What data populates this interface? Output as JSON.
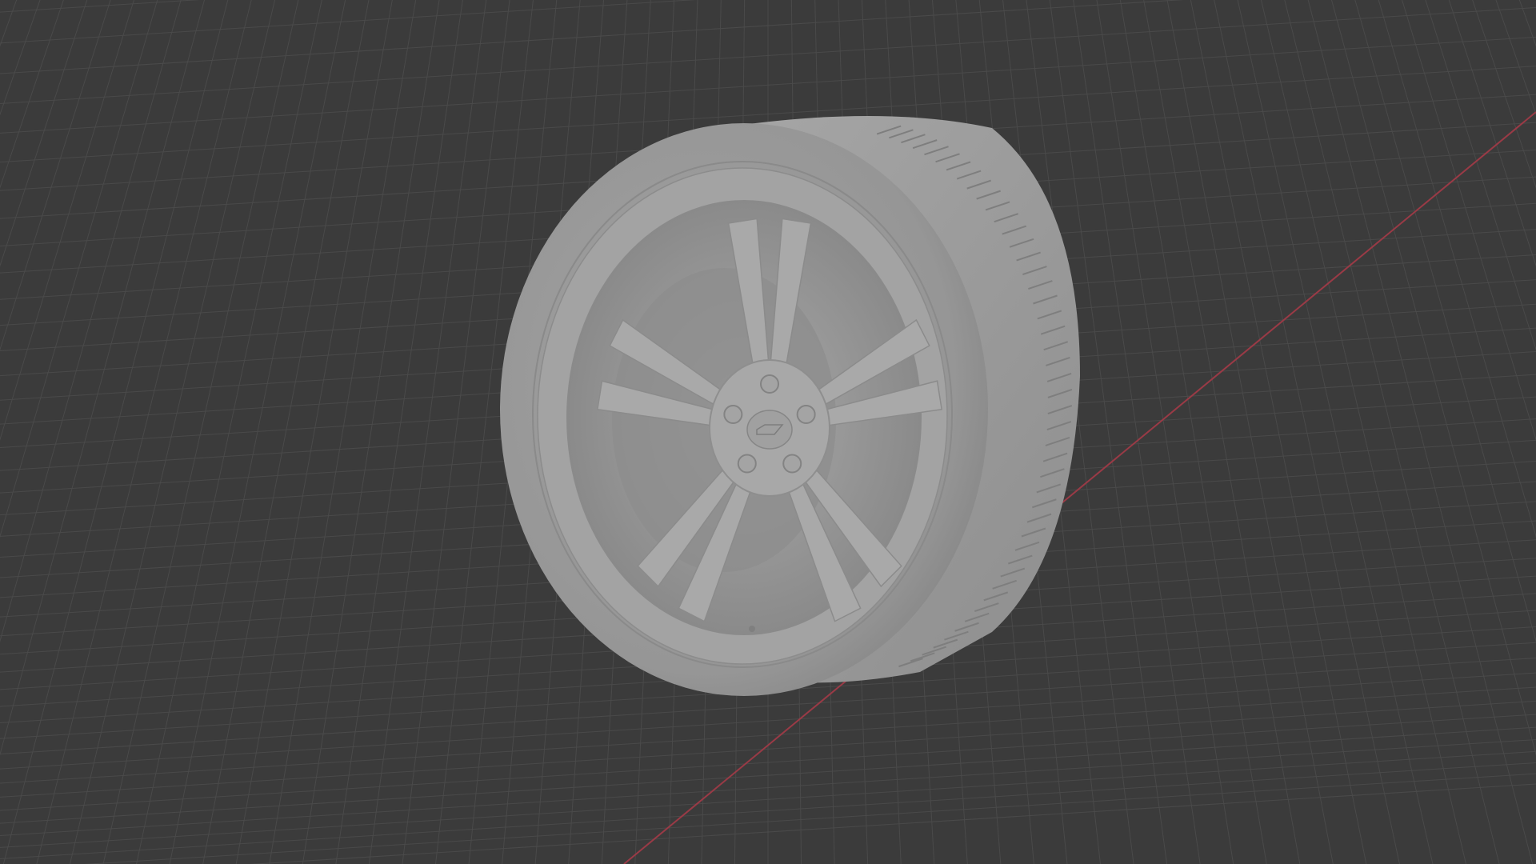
{
  "app": {
    "name": "3D Viewport"
  },
  "viewport": {
    "shading_mode": "solid",
    "background_color": "#3b3b3b",
    "grid": true,
    "grid_line_color": "#4a4a4a",
    "x_axis_visible": true,
    "x_axis_color": "#9a3a46"
  },
  "scene": {
    "object": {
      "name": "car-wheel",
      "type": "mesh",
      "parts": [
        "tire",
        "rim",
        "spokes",
        "hub",
        "lug-nuts",
        "center-cap",
        "valve-stem",
        "brake-disc"
      ],
      "spoke_count": 10,
      "lug_nut_count": 5,
      "material_color": "#9a9a9a"
    }
  }
}
